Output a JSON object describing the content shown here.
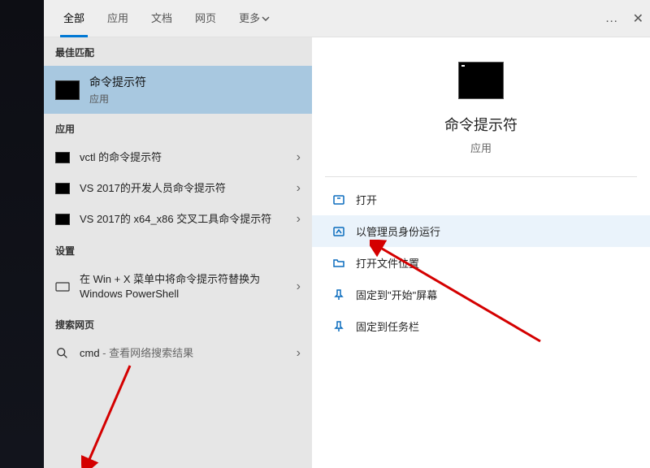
{
  "tabs": {
    "all": "全部",
    "apps": "应用",
    "docs": "文档",
    "web": "网页",
    "more": "更多"
  },
  "topright": {
    "dots": "…",
    "close": "✕"
  },
  "sections": {
    "best": "最佳匹配",
    "apps": "应用",
    "settings": "设置",
    "web": "搜索网页"
  },
  "best_match": {
    "title": "命令提示符",
    "subtitle": "应用"
  },
  "app_rows": [
    {
      "label": "vctl 的命令提示符"
    },
    {
      "label": "VS 2017的开发人员命令提示符"
    },
    {
      "label": "VS 2017的 x64_x86 交叉工具命令提示符"
    }
  ],
  "settings_rows": [
    {
      "label": "在 Win + X 菜单中将命令提示符替换为 Windows PowerShell"
    }
  ],
  "web_rows": {
    "prefix": "cmd",
    "suffix": " - 查看网络搜索结果"
  },
  "detail": {
    "title": "命令提示符",
    "subtitle": "应用"
  },
  "actions": [
    {
      "key": "open",
      "label": "打开"
    },
    {
      "key": "admin",
      "label": "以管理员身份运行"
    },
    {
      "key": "loc",
      "label": "打开文件位置"
    },
    {
      "key": "pinstart",
      "label": "固定到\"开始\"屏幕"
    },
    {
      "key": "pintask",
      "label": "固定到任务栏"
    }
  ]
}
